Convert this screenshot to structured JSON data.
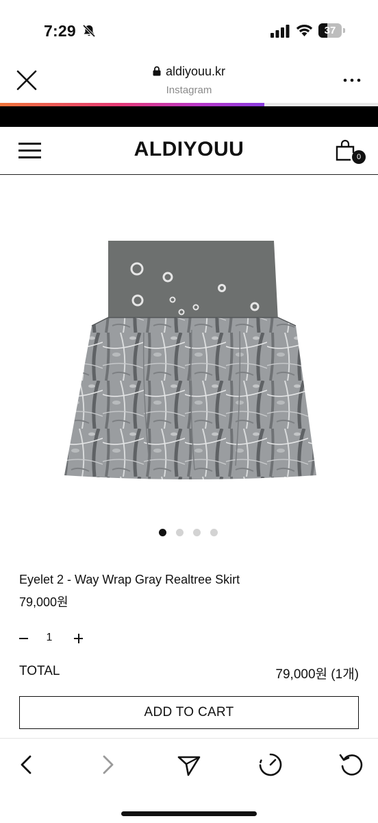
{
  "status_bar": {
    "time": "7:29",
    "battery": "37"
  },
  "browser": {
    "url": "aldiyouu.kr",
    "source": "Instagram",
    "load_progress_percent": 70
  },
  "store": {
    "brand": "ALDIYOUU",
    "cart_count": "0"
  },
  "gallery": {
    "image_count": 4,
    "active_index": 0
  },
  "product": {
    "name": "Eyelet 2 - Way Wrap Gray Realtree Skirt",
    "price": "79,000원"
  },
  "quantity": {
    "value": "1"
  },
  "total": {
    "label": "TOTAL",
    "value": "79,000원 (1개)"
  },
  "actions": {
    "add_to_cart_label": "ADD TO CART"
  },
  "colors": {
    "text": "#111111",
    "muted": "#8a8a8a",
    "progress_start": "#f0743a",
    "progress_end": "#8a3ce0"
  }
}
